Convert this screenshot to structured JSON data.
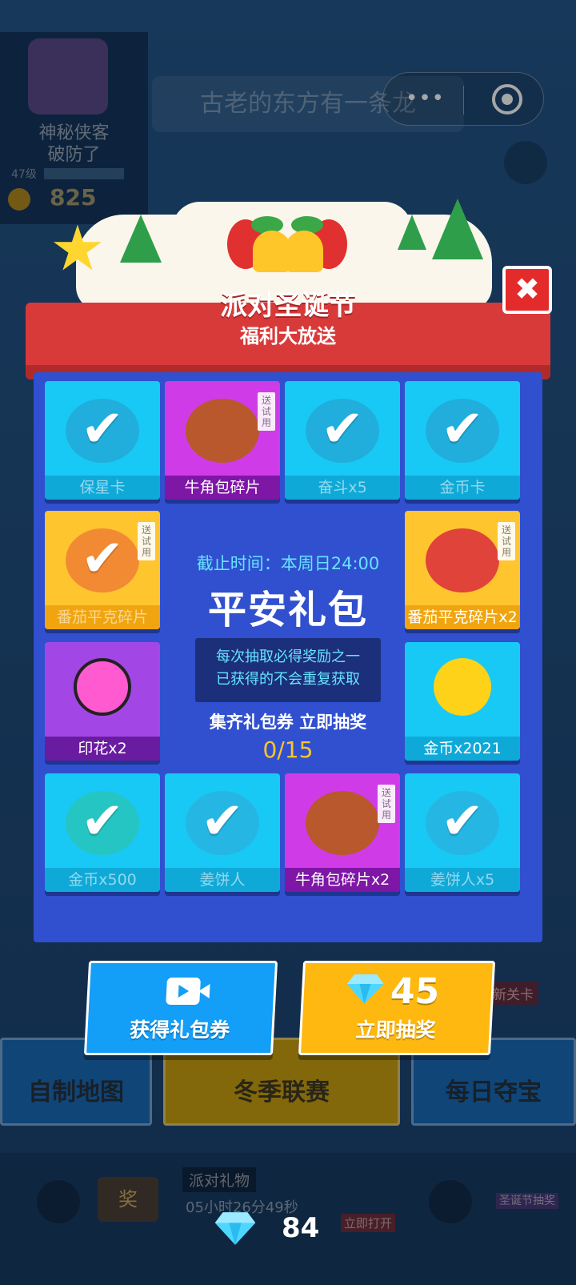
{
  "background": {
    "speech_text": "古老的东方有一条龙",
    "profile": {
      "name": "神秘侠客",
      "status": "破防了",
      "level": "47级",
      "coins": "825"
    },
    "buttons": {
      "custom_map": "自制地图",
      "winter_league": "冬季联赛",
      "daily_treasure": "每日夺宝",
      "new_level_tag": "新关卡"
    },
    "bottom": {
      "reward_icon_text": "奖",
      "party_gift_title": "派对礼物",
      "party_gift_timer": "05小时26分49秒",
      "open_now": "立即打开",
      "event_tag": "圣诞节抽奖"
    }
  },
  "capsule": {
    "more_icon": "more-dots-icon",
    "close_icon": "target-icon"
  },
  "modal": {
    "title": "派对圣诞节",
    "subtitle": "福利大放送",
    "close_symbol": "✖",
    "trial_badge": "送试用",
    "check_symbol": "✔",
    "items": [
      {
        "label": "保星卡",
        "theme": "cyan",
        "claimed": true,
        "icon": "shield-card-icon"
      },
      {
        "label": "牛角包碎片",
        "theme": "pink",
        "claimed": false,
        "trial": true,
        "icon": "croissant-bull-icon"
      },
      {
        "label": "奋斗x5",
        "theme": "cyan",
        "claimed": true,
        "icon": "fight-banner-icon"
      },
      {
        "label": "金币卡",
        "theme": "cyan",
        "claimed": true,
        "icon": "coin-card-icon"
      },
      {
        "label": "番茄平克碎片",
        "theme": "yellow",
        "claimed": true,
        "trial": true,
        "icon": "tomato-pig-icon"
      },
      {
        "label": "番茄平克碎片x2",
        "theme": "yellow",
        "claimed": false,
        "trial": true,
        "icon": "tomato-pig-icon"
      },
      {
        "label": "印花x2",
        "theme": "purple",
        "claimed": false,
        "icon": "lotus-stamp-icon"
      },
      {
        "label": "金币x2021",
        "theme": "cyan",
        "claimed": false,
        "icon": "gold-coin-icon"
      },
      {
        "label": "金币x500",
        "theme": "cyan",
        "claimed": true,
        "icon": "coin-pack-icon"
      },
      {
        "label": "姜饼人",
        "theme": "cyan",
        "claimed": true,
        "icon": "gingerbread-icon"
      },
      {
        "label": "牛角包碎片x2",
        "theme": "pink",
        "claimed": false,
        "trial": true,
        "icon": "croissant-bull-icon"
      },
      {
        "label": "姜饼人x5",
        "theme": "cyan",
        "claimed": true,
        "icon": "gingerbread-icon"
      }
    ],
    "center": {
      "deadline": "截止时间：本周日24:00",
      "title": "平安礼包",
      "desc_line1": "每次抽取必得奖励之一",
      "desc_line2": "已获得的不会重复获取",
      "hint": "集齐礼包券 立即抽奖",
      "progress": "0/15",
      "progress_value": 0,
      "progress_total": 15
    },
    "buttons": {
      "get_voucher": "获得礼包券",
      "draw_now": "立即抽奖",
      "draw_cost": "45"
    }
  },
  "footer": {
    "gem_count": "84"
  },
  "colors": {
    "panel": "#3050cf",
    "ribbon": "#d83a3a",
    "accent_cyan": "#66e3ff",
    "accent_gold": "#ffc52e"
  }
}
